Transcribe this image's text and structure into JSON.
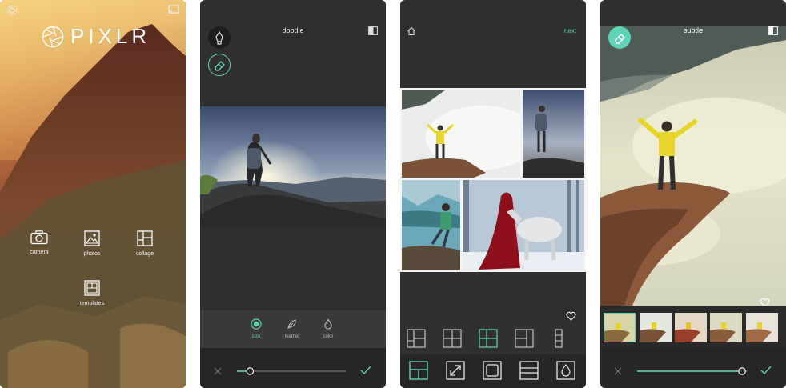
{
  "home": {
    "brand": "PIXLR",
    "actions": [
      {
        "label": "camera",
        "icon": "camera-icon"
      },
      {
        "label": "photos",
        "icon": "photos-icon"
      },
      {
        "label": "collage",
        "icon": "collage-icon"
      },
      {
        "label": "templates",
        "icon": "templates-icon"
      }
    ]
  },
  "doodle": {
    "title": "doodle",
    "tools": [
      {
        "label": "size",
        "icon": "size-icon",
        "active": true
      },
      {
        "label": "feather",
        "icon": "feather-icon",
        "active": false
      },
      {
        "label": "color",
        "icon": "color-drop-icon",
        "active": false
      }
    ],
    "slider_value": 0.12
  },
  "collage": {
    "next_label": "next"
  },
  "filter": {
    "title": "subtle",
    "thumbnails": [
      "",
      "",
      "",
      "",
      ""
    ],
    "slider_value": 0.95
  },
  "colors": {
    "accent": "#5ed3b6",
    "dark_bg": "#2f2f2f",
    "toolbar_bg": "#262626"
  }
}
